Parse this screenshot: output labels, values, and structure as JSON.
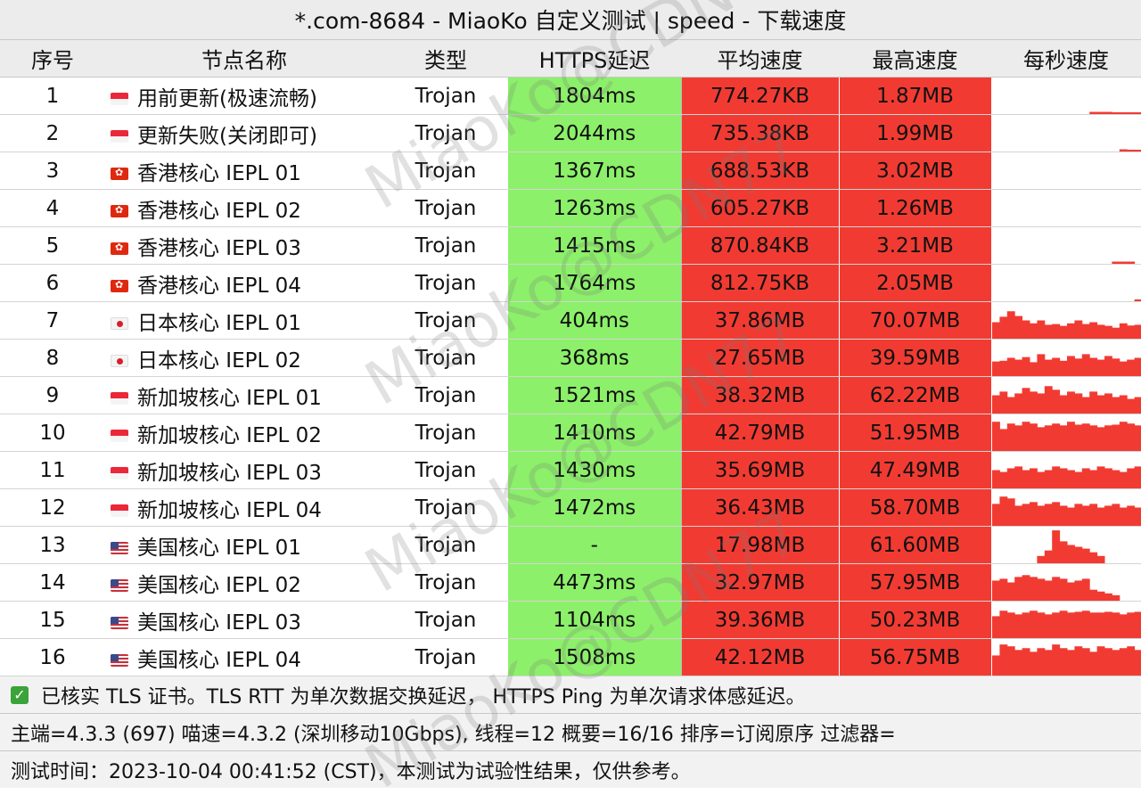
{
  "title": "*.com-8684 - MiaoKo 自定义测试 | speed - 下载速度",
  "headers": [
    "序号",
    "节点名称",
    "类型",
    "HTTPS延迟",
    "平均速度",
    "最高速度",
    "每秒速度"
  ],
  "colors": {
    "latency_bg": "#8cf06a",
    "speed_bg": "#f13b32",
    "spark": "#f13b32"
  },
  "rows": [
    {
      "idx": "1",
      "flag": "sg",
      "name": "用前更新(极速流畅)",
      "type": "Trojan",
      "latency": "1804ms",
      "avg": "774.27KB",
      "max": "1.87MB",
      "spark": [
        0,
        0,
        0,
        0,
        0,
        0,
        0,
        0,
        0,
        0,
        0,
        0,
        0,
        0.06,
        0.06,
        0.06,
        0.04,
        0.04,
        0.04,
        0.04
      ]
    },
    {
      "idx": "2",
      "flag": "sg",
      "name": "更新失败(关闭即可)",
      "type": "Trojan",
      "latency": "2044ms",
      "avg": "735.38KB",
      "max": "1.99MB",
      "spark": [
        0,
        0,
        0,
        0,
        0,
        0,
        0,
        0,
        0,
        0,
        0,
        0,
        0,
        0,
        0,
        0,
        0,
        0.06,
        0.04,
        0.04
      ]
    },
    {
      "idx": "3",
      "flag": "hk",
      "name": "香港核心 IEPL 01",
      "type": "Trojan",
      "latency": "1367ms",
      "avg": "688.53KB",
      "max": "3.02MB",
      "spark": [
        0,
        0,
        0,
        0,
        0,
        0,
        0,
        0,
        0,
        0,
        0,
        0,
        0,
        0,
        0,
        0,
        0,
        0,
        0,
        0
      ]
    },
    {
      "idx": "4",
      "flag": "hk",
      "name": "香港核心 IEPL 02",
      "type": "Trojan",
      "latency": "1263ms",
      "avg": "605.27KB",
      "max": "1.26MB",
      "spark": [
        0,
        0,
        0,
        0,
        0,
        0,
        0,
        0,
        0,
        0,
        0,
        0,
        0,
        0,
        0,
        0,
        0,
        0,
        0,
        0
      ]
    },
    {
      "idx": "5",
      "flag": "hk",
      "name": "香港核心 IEPL 03",
      "type": "Trojan",
      "latency": "1415ms",
      "avg": "870.84KB",
      "max": "3.21MB",
      "spark": [
        0,
        0,
        0,
        0,
        0,
        0,
        0,
        0,
        0,
        0,
        0,
        0,
        0,
        0,
        0,
        0,
        0.06,
        0.06,
        0.06,
        0
      ]
    },
    {
      "idx": "6",
      "flag": "hk",
      "name": "香港核心 IEPL 04",
      "type": "Trojan",
      "latency": "1764ms",
      "avg": "812.75KB",
      "max": "2.05MB",
      "spark": [
        0,
        0,
        0,
        0,
        0,
        0,
        0,
        0,
        0,
        0,
        0,
        0,
        0,
        0,
        0,
        0,
        0,
        0,
        0,
        0.04
      ]
    },
    {
      "idx": "7",
      "flag": "jp",
      "name": "日本核心 IEPL 01",
      "type": "Trojan",
      "latency": "404ms",
      "avg": "37.86MB",
      "max": "70.07MB",
      "spark": [
        0.45,
        0.6,
        0.75,
        0.62,
        0.5,
        0.42,
        0.5,
        0.38,
        0.4,
        0.35,
        0.42,
        0.5,
        0.4,
        0.45,
        0.38,
        0.35,
        0.3,
        0.42,
        0.36,
        0.38
      ]
    },
    {
      "idx": "8",
      "flag": "jp",
      "name": "日本核心 IEPL 02",
      "type": "Trojan",
      "latency": "368ms",
      "avg": "27.65MB",
      "max": "39.59MB",
      "spark": [
        0.4,
        0.42,
        0.5,
        0.45,
        0.52,
        0.38,
        0.6,
        0.45,
        0.5,
        0.42,
        0.55,
        0.48,
        0.6,
        0.5,
        0.45,
        0.55,
        0.48,
        0.4,
        0.45,
        0.5
      ]
    },
    {
      "idx": "9",
      "flag": "sg",
      "name": "新加坡核心 IEPL 01",
      "type": "Trojan",
      "latency": "1521ms",
      "avg": "38.32MB",
      "max": "62.22MB",
      "spark": [
        0.5,
        0.6,
        0.45,
        0.55,
        0.7,
        0.6,
        0.55,
        0.75,
        0.65,
        0.5,
        0.6,
        0.55,
        0.45,
        0.6,
        0.5,
        0.55,
        0.45,
        0.5,
        0.4,
        0.45
      ]
    },
    {
      "idx": "10",
      "flag": "sg",
      "name": "新加坡核心 IEPL 02",
      "type": "Trojan",
      "latency": "1410ms",
      "avg": "42.79MB",
      "max": "51.95MB",
      "spark": [
        0.8,
        0.6,
        0.75,
        0.7,
        0.8,
        0.75,
        0.65,
        0.7,
        0.75,
        0.7,
        0.8,
        0.72,
        0.75,
        0.7,
        0.65,
        0.7,
        0.72,
        0.8,
        0.75,
        0.7
      ]
    },
    {
      "idx": "11",
      "flag": "sg",
      "name": "新加坡核心 IEPL 03",
      "type": "Trojan",
      "latency": "1430ms",
      "avg": "35.69MB",
      "max": "47.49MB",
      "spark": [
        0.5,
        0.45,
        0.55,
        0.6,
        0.5,
        0.55,
        0.45,
        0.5,
        0.6,
        0.55,
        0.5,
        0.45,
        0.55,
        0.5,
        0.6,
        0.55,
        0.5,
        0.45,
        0.55,
        0.6
      ]
    },
    {
      "idx": "12",
      "flag": "sg",
      "name": "新加坡核心 IEPL 04",
      "type": "Trojan",
      "latency": "1472ms",
      "avg": "36.43MB",
      "max": "58.70MB",
      "spark": [
        0.6,
        0.8,
        0.75,
        0.55,
        0.6,
        0.65,
        0.55,
        0.6,
        0.65,
        0.55,
        0.5,
        0.6,
        0.55,
        0.6,
        0.5,
        0.55,
        0.6,
        0.5,
        0.55,
        0.5
      ]
    },
    {
      "idx": "13",
      "flag": "us",
      "name": "美国核心 IEPL 01",
      "type": "Trojan",
      "latency": "-",
      "avg": "17.98MB",
      "max": "61.60MB",
      "spark": [
        0,
        0,
        0,
        0,
        0,
        0,
        0.2,
        0.35,
        0.9,
        0.6,
        0.5,
        0.45,
        0.4,
        0.3,
        0.2,
        0,
        0,
        0,
        0,
        0
      ]
    },
    {
      "idx": "14",
      "flag": "us",
      "name": "美国核心 IEPL 02",
      "type": "Trojan",
      "latency": "4473ms",
      "avg": "32.97MB",
      "max": "57.95MB",
      "spark": [
        0.55,
        0.6,
        0.5,
        0.65,
        0.7,
        0.65,
        0.6,
        0.55,
        0.65,
        0.6,
        0.5,
        0.55,
        0.6,
        0.3,
        0.25,
        0.2,
        0.15,
        0,
        0,
        0
      ]
    },
    {
      "idx": "15",
      "flag": "us",
      "name": "美国核心 IEPL 03",
      "type": "Trojan",
      "latency": "1104ms",
      "avg": "39.36MB",
      "max": "50.23MB",
      "spark": [
        0.6,
        0.75,
        0.7,
        0.65,
        0.7,
        0.75,
        0.7,
        0.65,
        0.7,
        0.75,
        0.7,
        0.72,
        0.75,
        0.7,
        0.7,
        0.72,
        0.7,
        0.65,
        0.7,
        0.72
      ]
    },
    {
      "idx": "16",
      "flag": "us",
      "name": "美国核心 IEPL 04",
      "type": "Trojan",
      "latency": "1508ms",
      "avg": "42.12MB",
      "max": "56.75MB",
      "spark": [
        0.55,
        0.85,
        0.8,
        0.7,
        0.75,
        0.65,
        0.75,
        0.7,
        0.85,
        0.75,
        0.7,
        0.8,
        0.75,
        0.65,
        0.8,
        0.75,
        0.7,
        0.75,
        0.8,
        0.7
      ]
    }
  ],
  "footer": {
    "check_icon": "check-icon",
    "line1": "已核实 TLS 证书。TLS RTT 为单次数据交换延迟， HTTPS Ping 为单次请求体感延迟。",
    "line2": "主端=4.3.3 (697) 喵速=4.3.2 (深圳移动10Gbps), 线程=12 概要=16/16 排序=订阅原序 过滤器=",
    "line3": "测试时间：2023-10-04 00:41:52 (CST)，本测试为试验性结果，仅供参考。"
  },
  "watermark": "MiaoKo@CDN77"
}
